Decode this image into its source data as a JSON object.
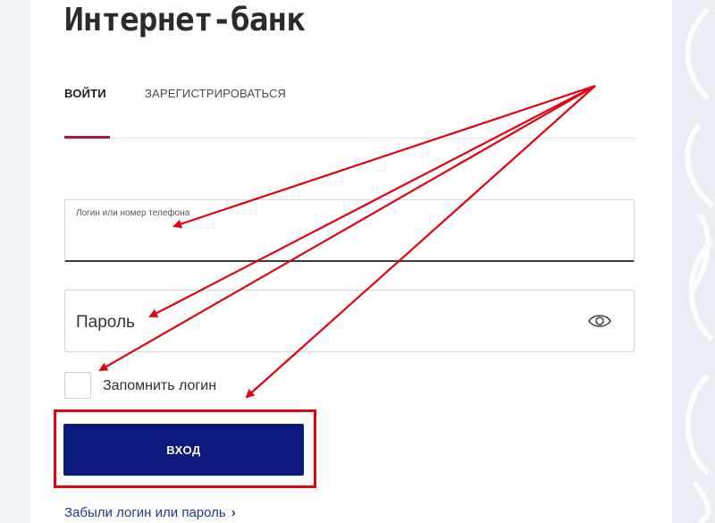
{
  "header": {
    "title": "Интернет-банк"
  },
  "tabs": [
    {
      "label": "ВОЙТИ",
      "active": true
    },
    {
      "label": "ЗАРЕГИСТРИРОВАТЬСЯ",
      "active": false
    }
  ],
  "form": {
    "login": {
      "label": "Логин или номер телефона",
      "value": ""
    },
    "password": {
      "placeholder": "Пароль",
      "value": "",
      "toggle_icon": "eye-icon"
    },
    "remember": {
      "label": "Запомнить логин",
      "checked": false
    },
    "submit_label": "ВХОД",
    "forgot_link": "Забыли логин или пароль",
    "forgot_icon": "chevron-right-icon"
  },
  "colors": {
    "accent": "#b3134a",
    "button": "#0c1a7d",
    "annotation": "#e3000f",
    "link": "#1f3a8a"
  }
}
